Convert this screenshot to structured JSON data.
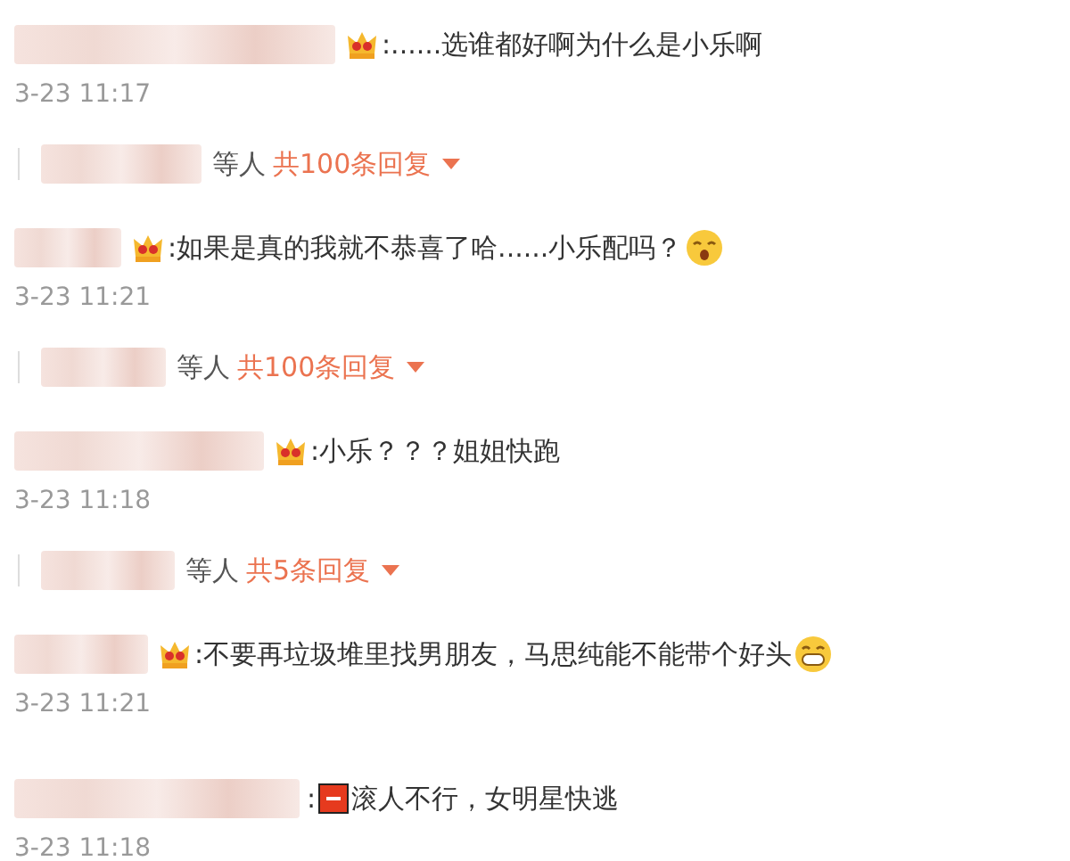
{
  "comments": [
    {
      "segments": [
        {
          "kind": "crown"
        },
        {
          "kind": "text",
          "text": ":......选谁都好啊为什么是小乐啊"
        }
      ],
      "time": "3-23 11:17",
      "replies": {
        "suffix": "等人",
        "count": "共100条回复"
      }
    },
    {
      "segments": [
        {
          "kind": "crown"
        },
        {
          "kind": "text",
          "text": ":如果是真的我就不恭喜了哈......小乐配吗？"
        },
        {
          "kind": "shock"
        }
      ],
      "time": "3-23 11:21",
      "replies": {
        "suffix": "等人",
        "count": "共100条回复"
      }
    },
    {
      "segments": [
        {
          "kind": "crown"
        },
        {
          "kind": "text",
          "text": ":小乐？？？姐姐快跑"
        }
      ],
      "time": "3-23 11:18",
      "replies": {
        "suffix": "等人",
        "count": "共5条回复"
      }
    },
    {
      "segments": [
        {
          "kind": "crown"
        },
        {
          "kind": "text",
          "text": ":不要再垃圾堆里找男朋友，马思纯能不能带个好头"
        },
        {
          "kind": "grin"
        }
      ],
      "time": "3-23 11:21"
    },
    {
      "segments": [
        {
          "kind": "text",
          "text": ":"
        },
        {
          "kind": "sos"
        },
        {
          "kind": "text",
          "text": "滚人不行，女明星快逃"
        }
      ],
      "time": "3-23 11:18"
    }
  ]
}
